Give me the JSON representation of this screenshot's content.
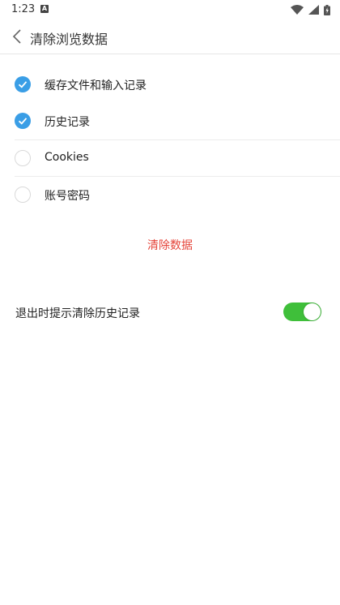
{
  "status_bar": {
    "time": "1:23",
    "notification_letter": "A"
  },
  "header": {
    "title": "清除浏览数据"
  },
  "options": [
    {
      "label": "缓存文件和输入记录",
      "checked": true
    },
    {
      "label": "历史记录",
      "checked": true
    },
    {
      "label": "Cookies",
      "checked": false
    },
    {
      "label": "账号密码",
      "checked": false
    }
  ],
  "clear_button": {
    "label": "清除数据"
  },
  "exit_prompt": {
    "label": "退出时提示清除历史记录",
    "enabled": true
  },
  "colors": {
    "check": "#3a9ee6",
    "clear_text": "#e5443a",
    "toggle_on": "#3fbf3a"
  }
}
